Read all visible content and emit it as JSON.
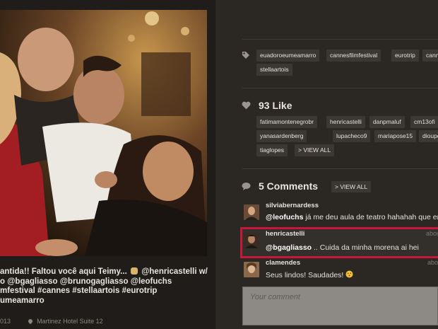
{
  "caption": {
    "line1": "antida!! Faltou você aqui Teimy...",
    "line1b": "@henricastelli w/",
    "line2": "o @bgagliasso @brunogagliasso @leofuchs",
    "line3": "mfestival #cannes #stellaartois #eurotrip",
    "line4": "umeamarro"
  },
  "meta": {
    "date": "013",
    "location": "Martinez Hotel Suite 12"
  },
  "tags_section": {
    "icon": "tag-icon",
    "tags": [
      "euadoroeumeamarro",
      "cannesfilmfestival",
      "eurotrip",
      "cann",
      "stellaartois"
    ]
  },
  "likes_section": {
    "icon": "heart-icon",
    "heading": "93 Like",
    "users": [
      "fatimamontenegrobr",
      "henricastelli",
      "danpmaluf",
      "cm13ofi",
      "yanasardenberg",
      "lupacheco9",
      "mariapose15",
      "dioupessor",
      "tiaglopes"
    ],
    "view_all": "> VIEW ALL"
  },
  "comments_section": {
    "icon": "comment-icon",
    "heading": "5 Comments",
    "view_all": "> VIEW ALL",
    "comments": [
      {
        "user": "silviabernardess",
        "handle": "@leofuchs",
        "text": " já me deu aula de teatro hahahah que engr",
        "time": ""
      },
      {
        "user": "henricastelli",
        "handle": "@bgagliasso",
        "text": " .. Cuida da minha morena ai hei",
        "time": "abou"
      },
      {
        "user": "clamendes",
        "handle": "",
        "text": "Seus lindos! Saudades!",
        "time": "abo"
      }
    ],
    "input_placeholder": "Your comment"
  },
  "colors": {
    "highlight": "#c8163d",
    "background": "#2b2824",
    "tag_bg": "#3b3733"
  }
}
